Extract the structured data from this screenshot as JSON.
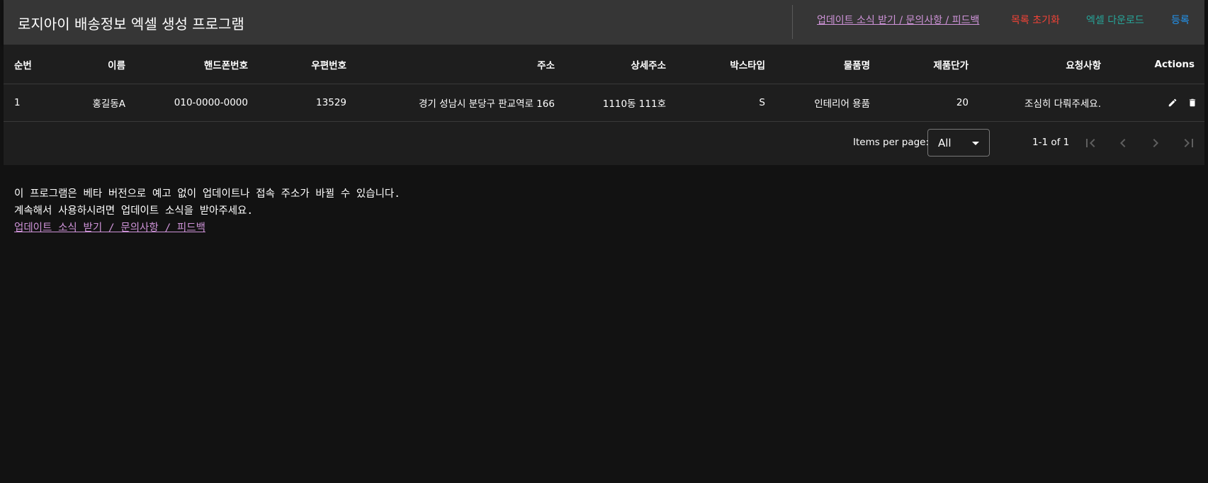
{
  "header": {
    "title": "로지아이 배송정보 엑셀 생성 프로그램",
    "updates_link": "업데이트 소식 받기 / 문의사항 / 피드백",
    "reset_button": "목록 초기화",
    "excel_button": "엑셀 다운로드",
    "register_button": "등록"
  },
  "table": {
    "columns": [
      "순번",
      "이름",
      "핸드폰번호",
      "우편번호",
      "주소",
      "상세주소",
      "박스타입",
      "물품명",
      "제품단가",
      "요청사항",
      "Actions"
    ],
    "rows": [
      [
        "1",
        "홍길동A",
        "010-0000-0000",
        "13529",
        "경기 성남시 분당구 판교역로 166",
        "1110동 111호",
        "S",
        "인테리어 용품",
        "20",
        "조심히 다뤄주세요."
      ]
    ],
    "action_icons": [
      "pencil-icon",
      "trash-icon"
    ]
  },
  "pagination": {
    "items_per_page_label": "Items per page:",
    "items_per_page_value": "All",
    "range_text": "1-1 of 1"
  },
  "notice": {
    "line1": "이 프로그램은 베타 버전으로 예고 없이 업데이트나 접속 주소가 바뀔 수 있습니다.",
    "line2": "계속해서 사용하시려면 업데이트 소식을 받아주세요.",
    "link": "업데이트 소식 받기 / 문의사항 / 피드백"
  },
  "colors": {
    "background": "#121212",
    "app_bar": "#363636",
    "card": "#1e1e1e",
    "link_purple": "#ce93d8",
    "reset_red": "#f44336",
    "excel_teal": "#26a69a",
    "register_blue": "#2196f3"
  }
}
